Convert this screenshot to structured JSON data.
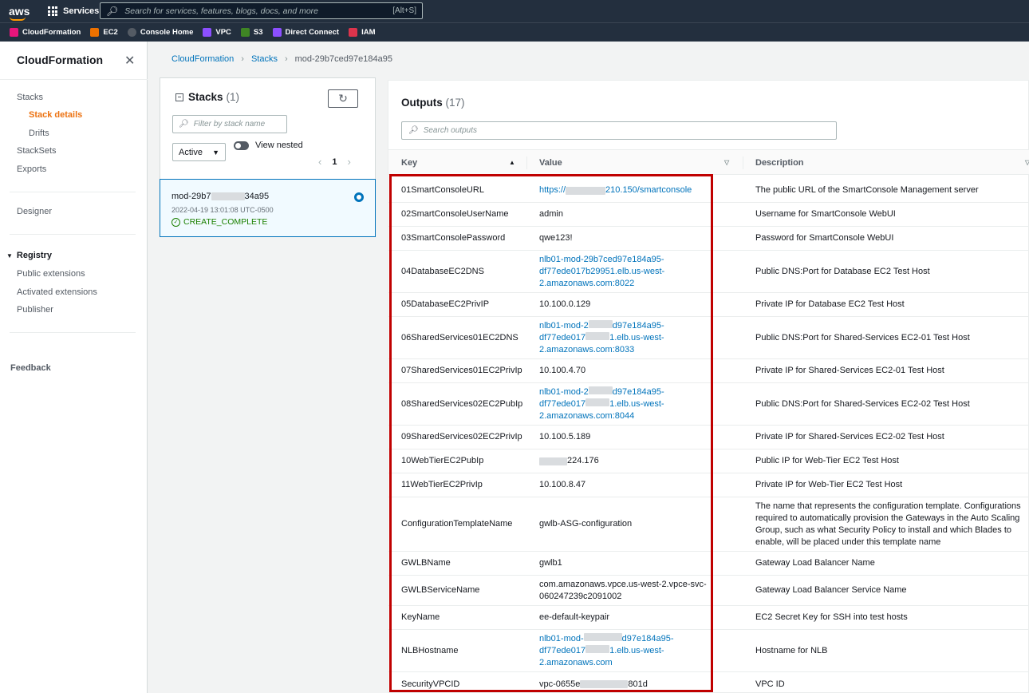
{
  "topbar": {
    "logo": "aws",
    "services_label": "Services",
    "search_placeholder": "Search for services, features, blogs, docs, and more",
    "search_shortcut": "[Alt+S]"
  },
  "favorites": [
    {
      "label": "CloudFormation",
      "color": "#e7157b"
    },
    {
      "label": "EC2",
      "color": "#ed7100"
    },
    {
      "label": "Console Home",
      "color": "#545b64"
    },
    {
      "label": "VPC",
      "color": "#8c4fff"
    },
    {
      "label": "S3",
      "color": "#3f8624"
    },
    {
      "label": "Direct Connect",
      "color": "#8c4fff"
    },
    {
      "label": "IAM",
      "color": "#dd344c"
    }
  ],
  "sidebar": {
    "title": "CloudFormation",
    "items": {
      "stacks": "Stacks",
      "stack_details": "Stack details",
      "drifts": "Drifts",
      "stacksets": "StackSets",
      "exports": "Exports",
      "designer": "Designer",
      "registry": "Registry",
      "public_extensions": "Public extensions",
      "activated_extensions": "Activated extensions",
      "publisher": "Publisher",
      "feedback": "Feedback"
    }
  },
  "breadcrumb": {
    "root": "CloudFormation",
    "stacks": "Stacks",
    "current": "mod-29b7ced97e184a95"
  },
  "stacks_panel": {
    "title": "Stacks",
    "count": "(1)",
    "filter_placeholder": "Filter by stack name",
    "status_filter": "Active",
    "view_nested": "View nested",
    "page": "1",
    "stack": {
      "name_prefix": "mod-29b7",
      "name_suffix": "34a95",
      "date": "2022-04-19 13:01:08 UTC-0500",
      "status": "CREATE_COMPLETE"
    }
  },
  "outputs": {
    "title": "Outputs",
    "count": "(17)",
    "search_placeholder": "Search outputs",
    "columns": {
      "key": "Key",
      "value": "Value",
      "description": "Description"
    },
    "rows": [
      {
        "key": "01SmartConsoleURL",
        "v1": "https://",
        "v2": "210.150/smartconsole",
        "desc": "The public URL of the SmartConsole Management server"
      },
      {
        "key": "02SmartConsoleUserName",
        "v1": "admin",
        "desc": "Username for SmartConsole WebUI"
      },
      {
        "key": "03SmartConsolePassword",
        "v1": "qwe123!",
        "desc": "Password for SmartConsole WebUI"
      },
      {
        "key": "04DatabaseEC2DNS",
        "v1": "nlb01-mod-29b7ced97e184a95-",
        "v2": "df77ede017b29951.elb.us-west-",
        "v3": "2.amazonaws.com:8022",
        "desc": "Public DNS:Port for Database EC2 Test Host"
      },
      {
        "key": "05DatabaseEC2PrivIP",
        "v1": "10.100.0.129",
        "desc": "Private IP for Database EC2 Test Host"
      },
      {
        "key": "06SharedServices01EC2DNS",
        "v1": "nlb01-mod-2",
        "v1b": "d97e184a95-",
        "v2": "df77ede017",
        "v2b": "1.elb.us-west-",
        "v3": "2.amazonaws.com:8033",
        "desc": "Public DNS:Port for Shared-Services EC2-01 Test Host"
      },
      {
        "key": "07SharedServices01EC2PrivIp",
        "v1": "10.100.4.70",
        "desc": "Private IP for Shared-Services EC2-01 Test Host"
      },
      {
        "key": "08SharedServices02EC2PubIp",
        "v1": "nlb01-mod-2",
        "v1b": "d97e184a95-",
        "v2": "df77ede017",
        "v2b": "1.elb.us-west-",
        "v3": "2.amazonaws.com:8044",
        "desc": "Public DNS:Port for Shared-Services EC2-02 Test Host"
      },
      {
        "key": "09SharedServices02EC2PrivIp",
        "v1": "10.100.5.189",
        "desc": "Private IP for Shared-Services EC2-02 Test Host"
      },
      {
        "key": "10WebTierEC2PubIp",
        "v1": "224.176",
        "desc": "Public IP for Web-Tier EC2 Test Host"
      },
      {
        "key": "11WebTierEC2PrivIp",
        "v1": "10.100.8.47",
        "desc": "Private IP for Web-Tier EC2 Test Host"
      },
      {
        "key": "ConfigurationTemplateName",
        "v1": "gwlb-ASG-configuration",
        "desc1": "The name that represents the configuration template. Configurations",
        "desc2": "required to automatically provision the Gateways in the Auto Scaling",
        "desc3": "Group, such as what Security Policy to install and which Blades to",
        "desc4": "enable, will be placed under this template name"
      },
      {
        "key": "GWLBName",
        "v1": "gwlb1",
        "desc": "Gateway Load Balancer Name"
      },
      {
        "key": "GWLBServiceName",
        "v1": "com.amazonaws.vpce.us-west-2.vpce-svc-",
        "v2": "060247239c2091002",
        "desc": "Gateway Load Balancer Service Name"
      },
      {
        "key": "KeyName",
        "v1": "ee-default-keypair",
        "desc": "EC2 Secret Key for SSH into test hosts"
      },
      {
        "key": "NLBHostname",
        "v1": "nlb01-mod-",
        "v1b": "d97e184a95-",
        "v2": "df77ede017",
        "v2b": "1.elb.us-west-",
        "v3": "2.amazonaws.com",
        "desc": "Hostname for NLB"
      },
      {
        "key": "SecurityVPCID",
        "v1": "vpc-0655e",
        "v1b": "801d",
        "desc": "VPC ID"
      }
    ]
  }
}
